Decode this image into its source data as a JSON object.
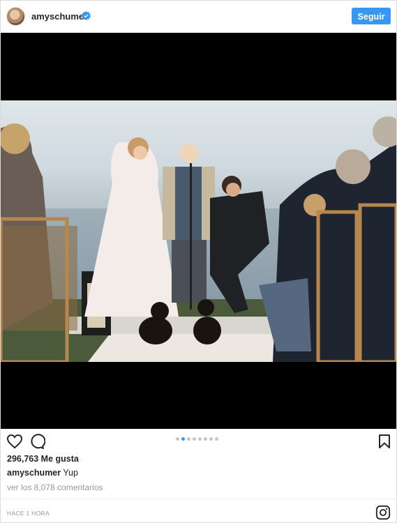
{
  "post": {
    "username": "amyschumer",
    "follow_label": "Seguir",
    "likes_text": "296,763 Me gusta",
    "caption_user": "amyschumer",
    "caption_text": "Yup",
    "comments_link": "ver los 8,078 comentarios",
    "timestamp": "HACE 1 HORA",
    "carousel_count": 8,
    "carousel_active": 2
  },
  "icons": {
    "verified": "verified-badge-icon",
    "like": "heart-icon",
    "comment": "comment-bubble-icon",
    "save": "bookmark-icon",
    "brand": "instagram-icon"
  },
  "colors": {
    "accent": "#3897f0",
    "text": "#262626",
    "muted": "#999999"
  }
}
